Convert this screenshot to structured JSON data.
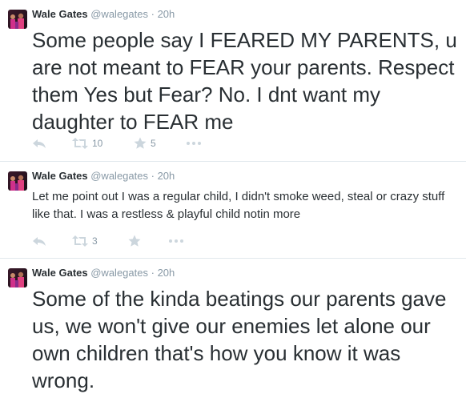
{
  "tweets": [
    {
      "name": "Wale Gates",
      "handle": "@walegates",
      "separator": "·",
      "time": "20h",
      "text": "Some people say I FEARED MY PARENTS, u are not meant to FEAR your parents. Respect them Yes but Fear? No. I dnt want my daughter to FEAR me",
      "retweets": "10",
      "favorites": "5"
    },
    {
      "name": "Wale Gates",
      "handle": "@walegates",
      "separator": "·",
      "time": "20h",
      "text": "Let me point out I was a regular child, I didn't smoke weed, steal or crazy stuff like that. I was a restless & playful child notin more",
      "retweets": "3"
    },
    {
      "name": "Wale Gates",
      "handle": "@walegates",
      "separator": "·",
      "time": "20h",
      "text": "Some of the kinda beatings our parents gave us, we won't give our enemies let alone our own children that's how you know it was wrong."
    }
  ],
  "icons": {
    "reply": "reply-icon",
    "retweet": "retweet-icon",
    "favorite": "star-icon",
    "more": "more-icon"
  },
  "colors": {
    "text": "#292f33",
    "secondary": "#8899a6",
    "action_icon": "#ccd6dd",
    "divider": "#e1e8ed"
  }
}
